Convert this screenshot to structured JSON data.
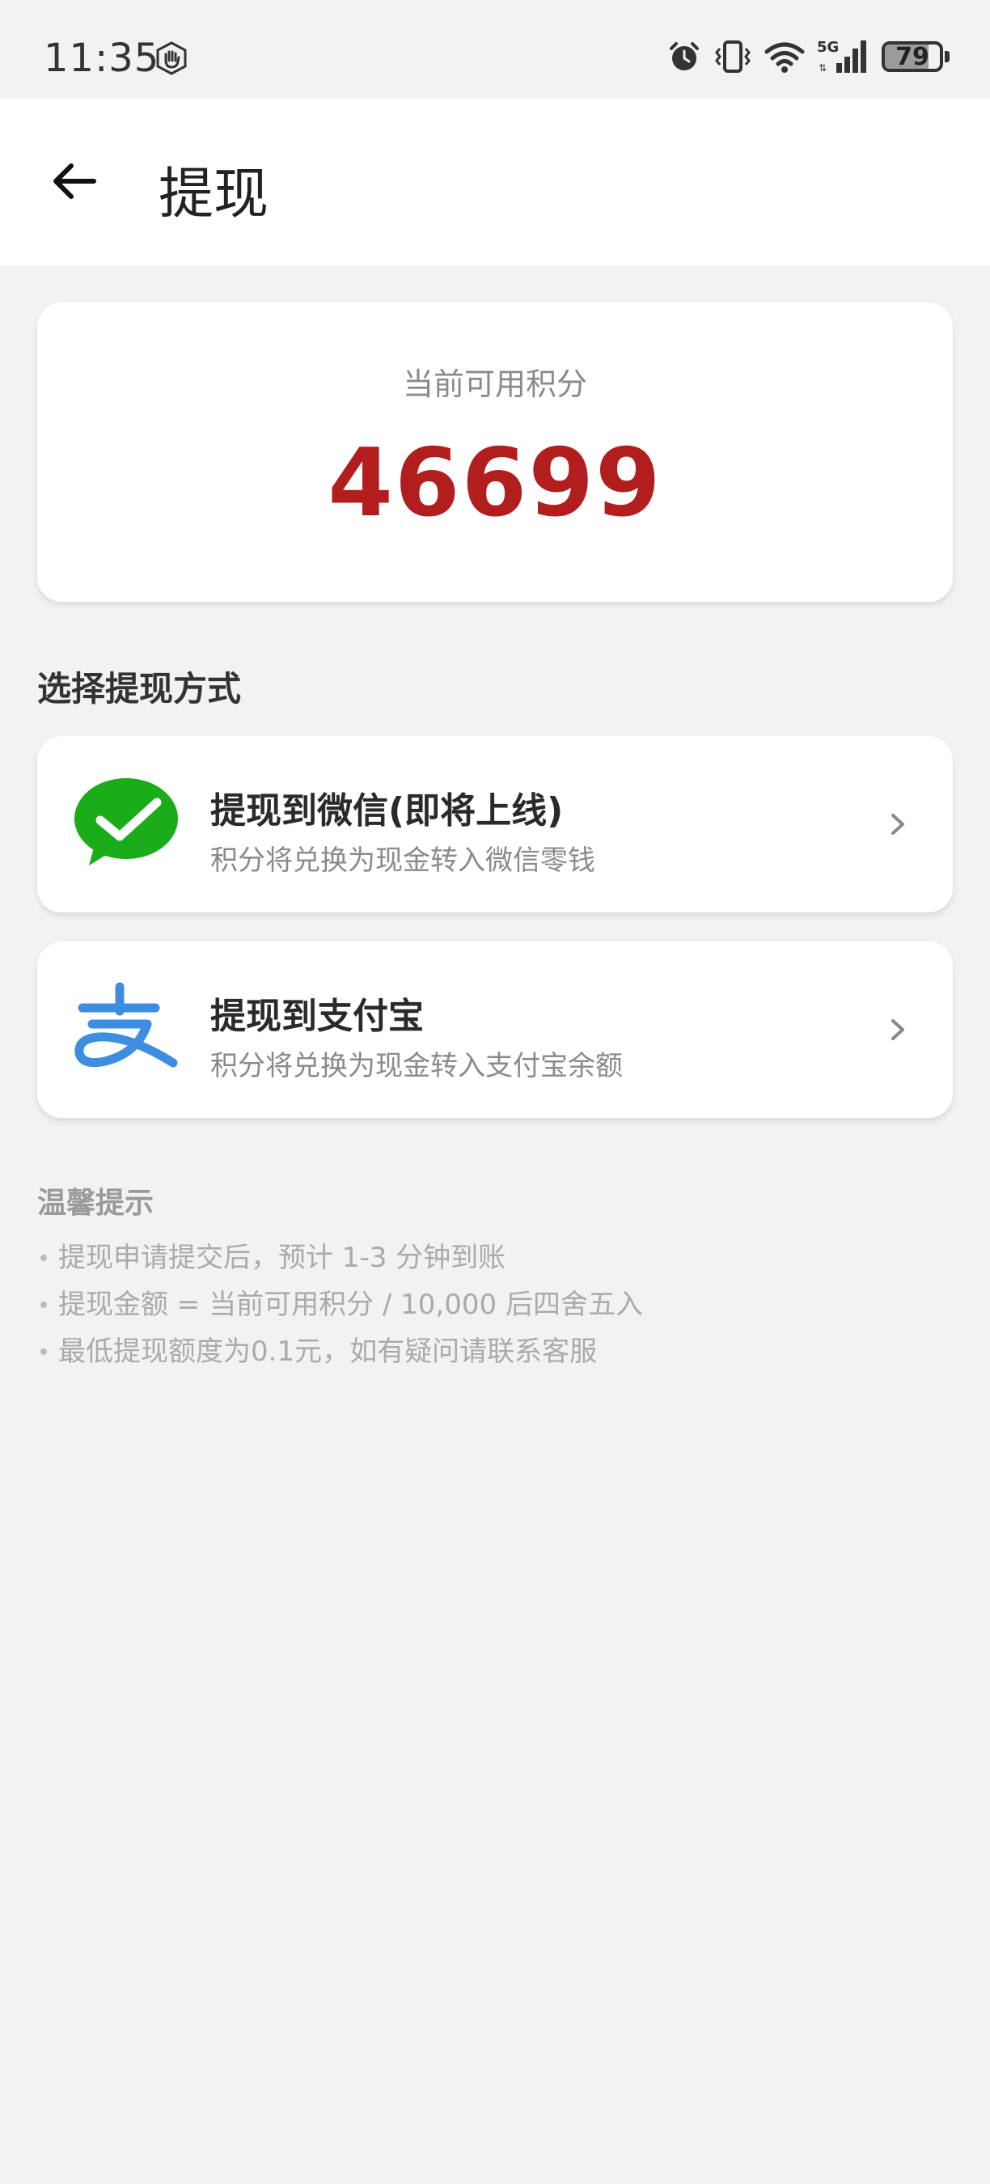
{
  "status_bar": {
    "time": "11:35",
    "battery": "79",
    "network": "5G",
    "icons": [
      "hand-badge-icon",
      "alarm-icon",
      "vibrate-icon",
      "wifi-icon",
      "signal-icon",
      "battery-icon"
    ]
  },
  "header": {
    "back_icon": "arrow-left-icon",
    "title": "提现"
  },
  "points": {
    "label": "当前可用积分",
    "value": "46699",
    "value_color": "#b21e1e"
  },
  "section_title": "选择提现方式",
  "options": [
    {
      "icon": "wechat-icon",
      "title": "提现到微信(即将上线)",
      "description": "积分将兑换为现金转入微信零钱",
      "icon_color": "#1aad19"
    },
    {
      "icon": "alipay-icon",
      "title": "提现到支付宝",
      "description": "积分将兑换为现金转入支付宝余额",
      "icon_color": "#3d8ee0"
    }
  ],
  "tips": {
    "title": "温馨提示",
    "items": [
      "提现申请提交后，预计 1-3 分钟到账",
      "提现金额 = 当前可用积分 / 10,000 后四舍五入",
      "最低提现额度为0.1元，如有疑问请联系客服"
    ]
  }
}
